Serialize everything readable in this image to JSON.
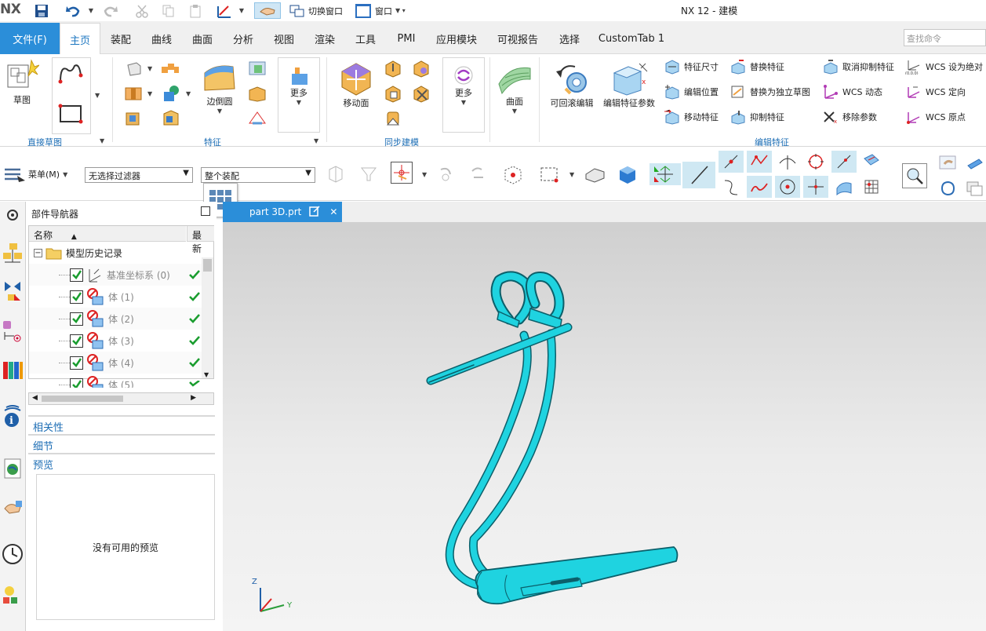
{
  "app": {
    "logo": "NX",
    "title": "NX 12 - 建模",
    "quick_access": {
      "switch_window_label": "切换窗口",
      "window_label": "窗口"
    }
  },
  "tabs": {
    "file": "文件(F)",
    "items": [
      "主页",
      "装配",
      "曲线",
      "曲面",
      "分析",
      "视图",
      "渲染",
      "工具",
      "PMI",
      "应用模块",
      "可视报告",
      "选择",
      "CustomTab 1"
    ],
    "active_index": 0,
    "search_placeholder": "查找命令"
  },
  "ribbon": {
    "direct_sketch": {
      "sketch_label": "草图",
      "group_label": "直接草图"
    },
    "feature": {
      "blend_label": "边倒圆",
      "more_label": "更多",
      "group_label": "特征"
    },
    "sync": {
      "move_face_label": "移动面",
      "more_label": "更多",
      "group_label": "同步建模"
    },
    "surface": {
      "surface_label": "曲面"
    },
    "edit_feature": {
      "rollback_label": "可回滚编辑",
      "edit_params_label": "编辑特征参数",
      "feature_dim": "特征尺寸",
      "edit_position": "编辑位置",
      "move_feature": "移动特征",
      "replace_feature": "替换特征",
      "replace_sketch": "替换为独立草图",
      "suppress_feature": "抑制特征",
      "unsuppress_feature": "取消抑制特征",
      "wcs_dynamic": "WCS 动态",
      "remove_params": "移除参数",
      "group_label": "编辑特征"
    },
    "wcs": {
      "set_absolute": "WCS 设为绝对",
      "orient": "WCS 定向",
      "origin": "WCS 原点"
    }
  },
  "toolbar": {
    "menu_label": "菜单(M)",
    "filter_value": "无选择过滤器",
    "scope_value": "整个装配"
  },
  "navigator": {
    "title": "部件导航器",
    "col_name": "名称",
    "col_latest": "最新",
    "root_label": "模型历史记录",
    "rows": [
      "基准坐标系 (0)",
      "体 (1)",
      "体 (2)",
      "体 (3)",
      "体 (4)",
      "体 (5)"
    ],
    "sections": [
      "相关性",
      "细节",
      "预览"
    ],
    "no_preview": "没有可用的预览"
  },
  "document": {
    "tab_name": "part 3D.prt"
  },
  "triad": {
    "z": "Z",
    "y": "Y"
  },
  "colors": {
    "accent": "#2b8ed9",
    "model": "#1fd3e0",
    "model_edge": "#0b5f6a",
    "ribbon_label": "#1d6eb5"
  }
}
